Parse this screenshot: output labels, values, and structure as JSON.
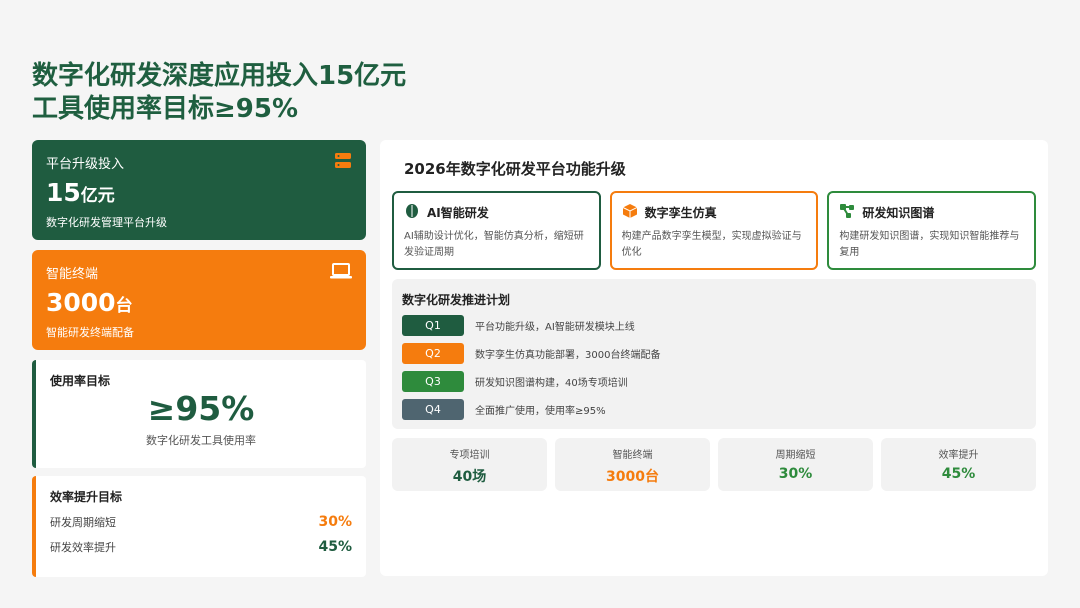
{
  "title": {
    "line1": "数字化研发深度应用投入15亿元",
    "line2": "工具使用率目标≥95%"
  },
  "colors": {
    "green": "#1f5c40",
    "orange": "#f57c0e",
    "mid_green": "#2e8b3c",
    "slate": "#4f6570"
  },
  "kpis": [
    {
      "label": "平台升级投入",
      "value": "15",
      "unit": "亿元",
      "sub": "数字化研发管理平台升级",
      "icon": "server-icon"
    },
    {
      "label": "智能终端",
      "value": "3000",
      "unit": "台",
      "sub": "智能研发终端配备",
      "icon": "laptop-icon"
    }
  ],
  "usage": {
    "label": "使用率目标",
    "value": "≥95%",
    "sub": "数字化研发工具使用率"
  },
  "efficiency": {
    "label": "效率提升目标",
    "rows": [
      {
        "name": "研发周期缩短",
        "value": "30%"
      },
      {
        "name": "研发效率提升",
        "value": "45%"
      }
    ]
  },
  "panel": {
    "title": "2026年数字化研发平台功能升级",
    "features": [
      {
        "title": "AI智能研发",
        "desc": "AI辅助设计优化，智能仿真分析，缩短研发验证周期",
        "icon": "brain-icon"
      },
      {
        "title": "数字孪生仿真",
        "desc": "构建产品数字孪生模型，实现虚拟验证与优化",
        "icon": "cube-icon"
      },
      {
        "title": "研发知识图谱",
        "desc": "构建研发知识图谱，实现知识智能推荐与复用",
        "icon": "network-icon"
      }
    ],
    "plan": {
      "title": "数字化研发推进计划",
      "rows": [
        {
          "q": "Q1",
          "text": "平台功能升级，AI智能研发模块上线"
        },
        {
          "q": "Q2",
          "text": "数字孪生仿真功能部署，3000台终端配备"
        },
        {
          "q": "Q3",
          "text": "研发知识图谱构建，40场专项培训"
        },
        {
          "q": "Q4",
          "text": "全面推广使用，使用率≥95%"
        }
      ]
    },
    "stats": [
      {
        "label": "专项培训",
        "value": "40场"
      },
      {
        "label": "智能终端",
        "value": "3000台"
      },
      {
        "label": "周期缩短",
        "value": "30%"
      },
      {
        "label": "效率提升",
        "value": "45%"
      }
    ]
  }
}
